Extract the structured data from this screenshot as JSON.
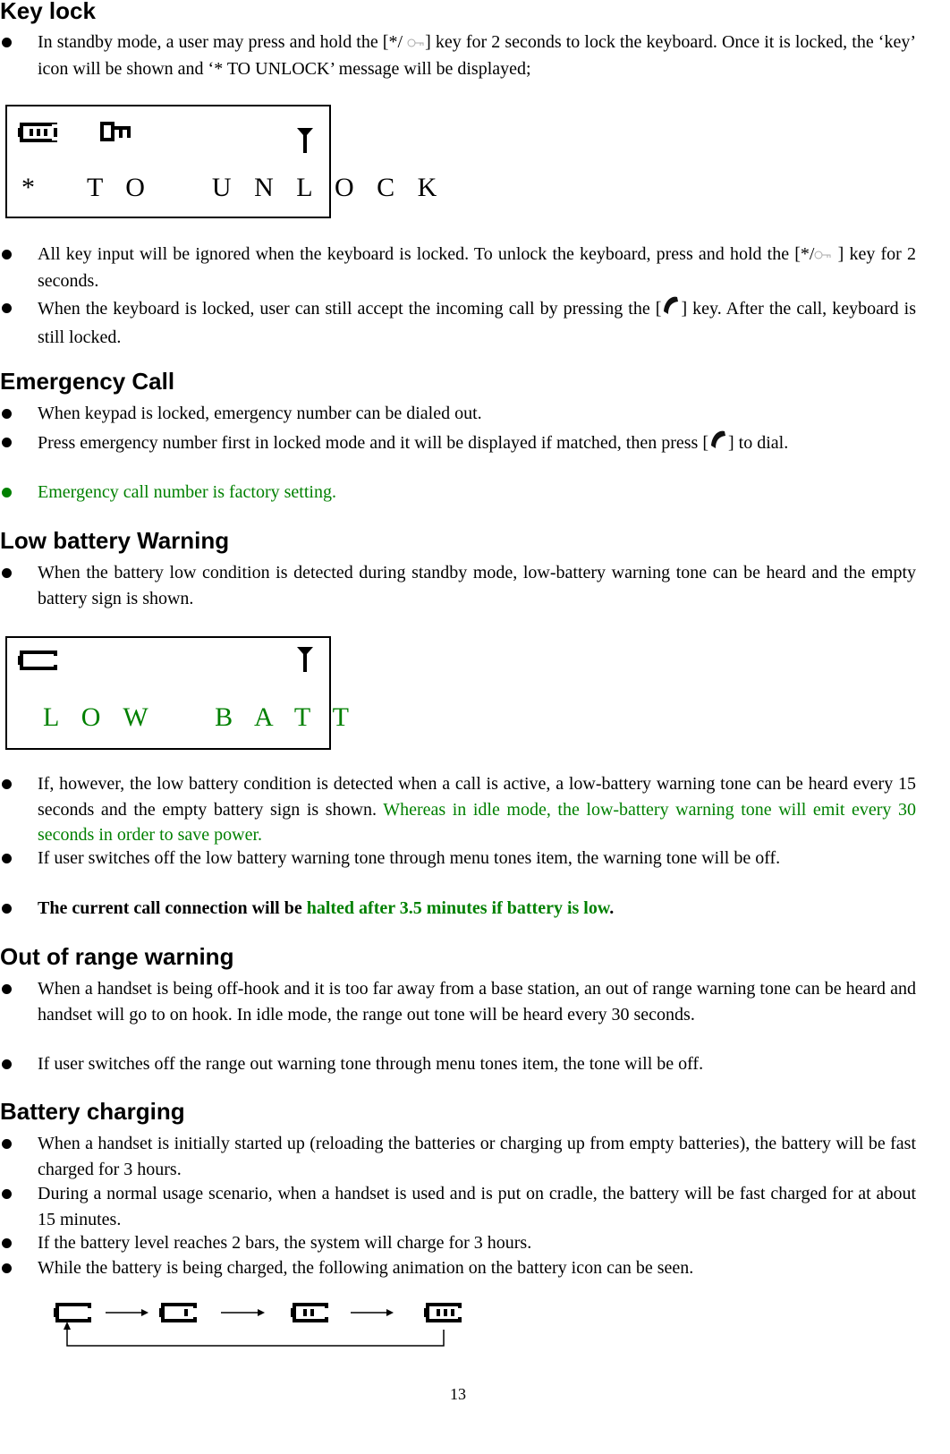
{
  "sections": [
    {
      "title": "Key lock",
      "bullets": [
        {
          "parts": [
            "In standby mode, a user may press and hold the [*/ ",
            "] key for 2 seconds to lock the keyboard. Once it is locked, the ‘key’ icon will be shown and ‘* TO UNLOCK’ message will be displayed;"
          ],
          "icon": "key-icon"
        }
      ],
      "lcd": {
        "status_icons": [
          "battery-full-icon",
          "key-lock-icon",
          "signal-antenna-icon"
        ],
        "message": "*   T O    U N L O C K",
        "message_color": "#000000"
      },
      "bullets_after": [
        {
          "parts": [
            "All key input will be ignored when the keyboard is locked. To unlock the keyboard, press and hold the [*/",
            " ] key for 2 seconds."
          ],
          "icon": "key-icon"
        },
        {
          "parts": [
            "When the keyboard is locked, user can still accept the incoming call by pressing the [",
            "] key. After the call, keyboard is still locked."
          ],
          "icon": "phone-handset-icon"
        }
      ]
    },
    {
      "title": "Emergency Call",
      "bullets": [
        {
          "text": "When keypad is locked, emergency number can be dialed out."
        },
        {
          "parts": [
            "Press emergency number first in locked mode and it will be displayed if matched, then press [",
            "]    to dial."
          ],
          "icon": "phone-handset-icon"
        },
        {
          "text": "Emergency call number is factory setting.",
          "color": "#008000"
        }
      ]
    },
    {
      "title": "Low battery Warning",
      "bullets": [
        {
          "text": "When the battery low condition is detected during standby mode, low-battery warning tone can be heard and the empty battery sign is shown."
        }
      ],
      "lcd": {
        "status_icons": [
          "battery-empty-icon",
          "signal-antenna-icon"
        ],
        "message": "L O W    B A T T",
        "message_color": "#008000"
      },
      "bullets_after": [
        {
          "text": "If, however, the low battery condition is detected when a call is active, a low-battery warning tone can be heard every 15 seconds and the empty battery sign is shown. ",
          "green_text": "Whereas in idle mode, the low-battery warning tone will emit every 30 seconds in order to save power."
        },
        {
          "text": "If user switches off the low battery warning tone through menu tones item, the warning tone will be off."
        },
        {
          "bold_text": "The current call connection will be ",
          "bold_green_text": "halted after 3.5 minutes if battery is low",
          "bold_tail": "."
        }
      ]
    },
    {
      "title": "Out of range warning",
      "bullets": [
        {
          "text": "When a handset is being off-hook and it is too far away from a base station, an out of range warning tone can be heard and handset will go to on hook. In idle mode, the range out tone will be heard every 30 seconds."
        },
        {
          "text": "If user switches off the range out warning tone through menu tones item, the tone will be off."
        }
      ]
    },
    {
      "title": "Battery charging",
      "bullets": [
        {
          "text": "When a handset is initially started up (reloading the batteries or charging up from empty batteries), the battery will be fast charged for 3 hours."
        },
        {
          "text": "During a normal usage scenario, when a handset is used and is put on cradle, the battery will be fast charged for at about 15 minutes."
        },
        {
          "text": "If the battery level reaches 2 bars, the system will charge for 3 hours."
        },
        {
          "text": "While the battery is being charged, the following animation on the battery icon can be seen."
        }
      ],
      "charging_animation": {
        "frames": [
          {
            "icon": "battery-empty-icon",
            "bars": 0
          },
          {
            "icon": "battery-one-bar-icon",
            "bars": 1
          },
          {
            "icon": "battery-two-bars-icon",
            "bars": 2
          },
          {
            "icon": "battery-three-bars-icon",
            "bars": 3
          }
        ],
        "loops_back": true
      }
    }
  ],
  "page_number": "13",
  "colors": {
    "text": "#000000",
    "accent_green": "#008000"
  }
}
